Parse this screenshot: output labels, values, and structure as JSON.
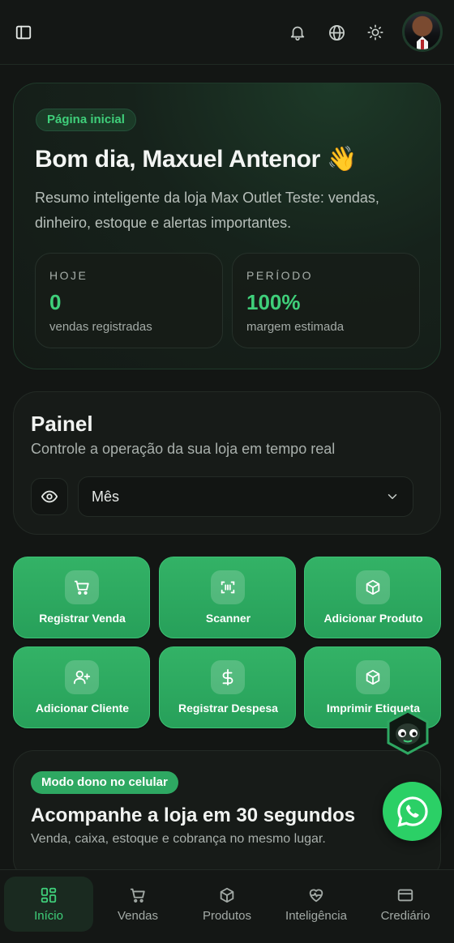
{
  "header": {
    "icons": [
      "sidebar-toggle-icon",
      "bell-icon",
      "globe-icon",
      "sun-icon",
      "avatar"
    ]
  },
  "hero": {
    "badge": "Página inicial",
    "title": "Bom dia, Maxuel Antenor 👋",
    "description": "Resumo inteligente da loja Max Outlet Teste: vendas, dinheiro, estoque e alertas importantes.",
    "stats": [
      {
        "key": "HOJE",
        "value": "0",
        "sub": "vendas registradas"
      },
      {
        "key": "PERÍODO",
        "value": "100%",
        "sub": "margem estimada"
      }
    ]
  },
  "panel": {
    "title": "Painel",
    "subtitle": "Controle a operação da sua loja em tempo real",
    "period_select": "Mês"
  },
  "actions": [
    {
      "label": "Registrar Venda",
      "icon": "cart-icon"
    },
    {
      "label": "Scanner",
      "icon": "barcode-scan-icon"
    },
    {
      "label": "Adicionar Produto",
      "icon": "box-icon"
    },
    {
      "label": "Adicionar Cliente",
      "icon": "user-plus-icon"
    },
    {
      "label": "Registrar Despesa",
      "icon": "dollar-icon"
    },
    {
      "label": "Imprimir Etiqueta",
      "icon": "box-icon"
    }
  ],
  "mode": {
    "badge": "Modo dono no celular",
    "title": "Acompanhe a loja em 30 segundos",
    "subtitle": "Venda, caixa, estoque e cobrança no mesmo lugar."
  },
  "bottom_nav": [
    {
      "label": "Início",
      "icon": "grid-icon",
      "active": true
    },
    {
      "label": "Vendas",
      "icon": "cart-icon",
      "active": false
    },
    {
      "label": "Produtos",
      "icon": "box-icon",
      "active": false
    },
    {
      "label": "Inteligência",
      "icon": "heart-pulse-icon",
      "active": false
    },
    {
      "label": "Crediário",
      "icon": "credit-card-icon",
      "active": false
    }
  ],
  "colors": {
    "accent": "#3fcf7a",
    "tile": "#2ea862",
    "background": "#131614",
    "whatsapp": "#2bd066"
  }
}
